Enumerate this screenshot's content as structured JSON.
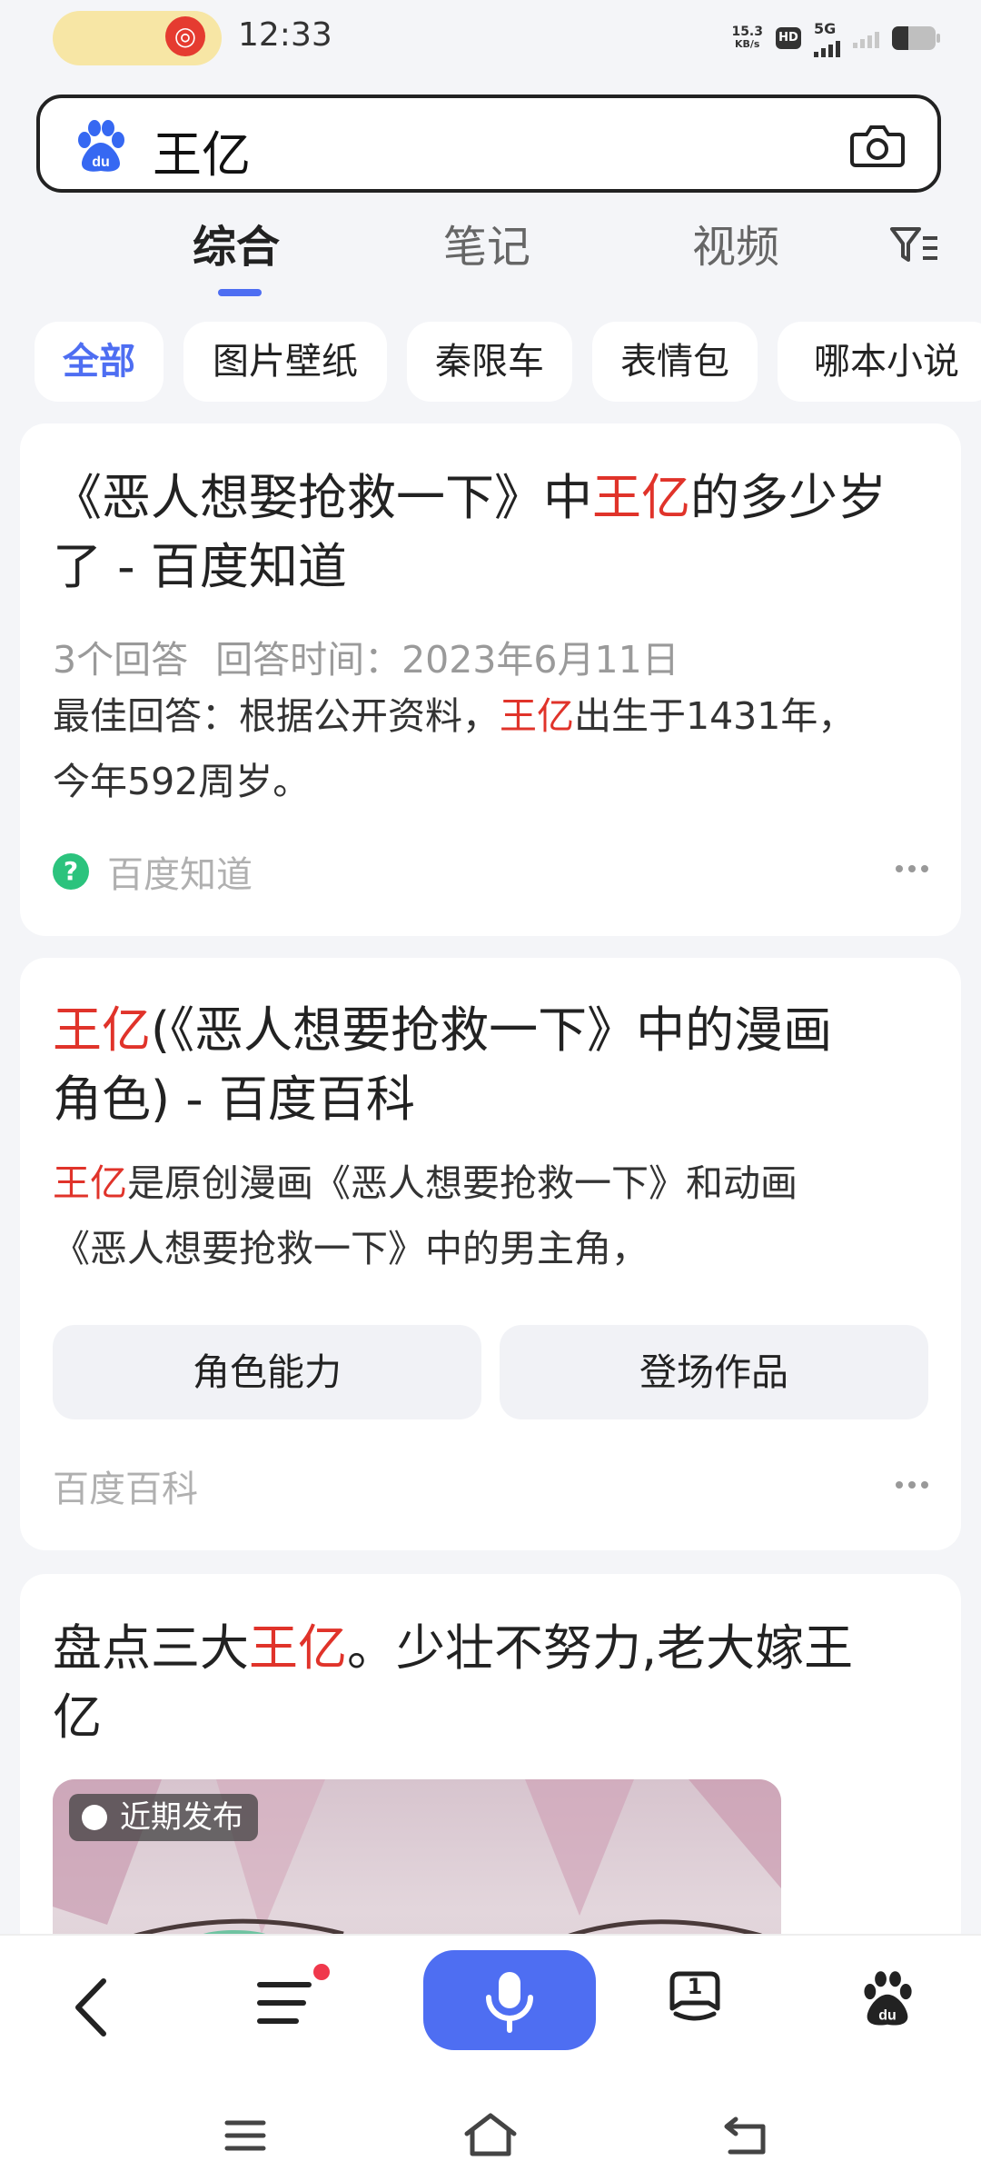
{
  "status_bar": {
    "time": "12:33",
    "speed_value": "15.3",
    "speed_unit": "KB/s",
    "hd_label": "HD",
    "network": "5G"
  },
  "search": {
    "query": "王亿",
    "logo_icon": "baidu-paw-icon",
    "camera_icon": "camera-icon"
  },
  "tabs": [
    {
      "label": "综合",
      "active": true
    },
    {
      "label": "笔记",
      "active": false
    },
    {
      "label": "视频",
      "active": false
    }
  ],
  "filter_icon": "filter-icon",
  "chips": [
    {
      "label": "全部",
      "active": true
    },
    {
      "label": "图片壁纸",
      "active": false
    },
    {
      "label": "秦限车",
      "active": false
    },
    {
      "label": "表情包",
      "active": false
    },
    {
      "label": "哪本小说",
      "active": false
    }
  ],
  "results": [
    {
      "title_line1_pre": "《恶人想娶抢救一下》中",
      "title_line1_highlight": "王亿",
      "title_line1_post": "的多少岁",
      "title_line2": "了 - 百度知道",
      "meta_answers": "3个回答",
      "meta_time": "回答时间：2023年6月11日",
      "body_line1_pre": "最佳回答：根据公开资料，",
      "body_line1_highlight": "王亿",
      "body_line1_post": "出生于1431年，",
      "body_line2": "今年592周岁。",
      "source": "百度知道"
    },
    {
      "title_line1_highlight": "王亿",
      "title_line1_post": "(《恶人想要抢救一下》中的漫画",
      "title_line2": "角色) - 百度百科",
      "body_line1_highlight": "王亿",
      "body_line1_post": "是原创漫画《恶人想要抢救一下》和动画",
      "body_line2": "《恶人想要抢救一下》中的男主角，",
      "buttons": [
        "角色能力",
        "登场作品"
      ],
      "source": "百度百科"
    },
    {
      "title_line1_pre": "盘点三大",
      "title_line1_highlight": "王亿",
      "title_line1_post": "。少壮不努力,老大嫁王",
      "title_line2": "亿",
      "badge": "近期发布"
    }
  ],
  "bottom_nav": {
    "back_icon": "back-icon",
    "menu_icon": "menu-icon",
    "mic_icon": "microphone-icon",
    "tabs_count": "1",
    "home_icon": "baidu-paw-icon"
  },
  "colors": {
    "accent": "#4e6ef2",
    "highlight": "#e0332a",
    "background": "#f4f5f8"
  }
}
